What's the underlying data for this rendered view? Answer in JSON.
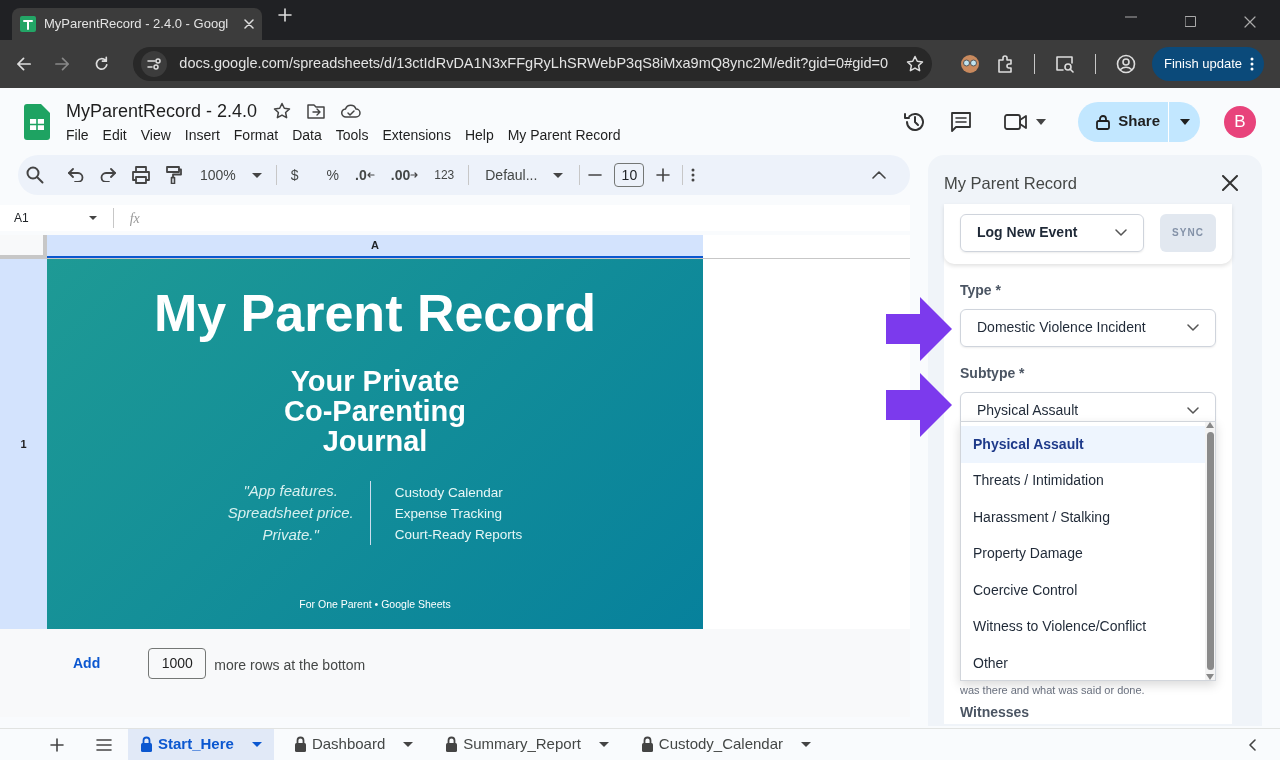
{
  "browser": {
    "tab_title": "MyParentRecord - 2.4.0 - Googl",
    "url": "docs.google.com/spreadsheets/d/13ctIdRvDA1N3xFFgRyLhSRWebP3qS8iMxa9mQ8ync2M/edit?gid=0#gid=0",
    "update_button": "Finish update"
  },
  "sheets": {
    "doc_title": "MyParentRecord - 2.4.0",
    "menus": [
      "File",
      "Edit",
      "View",
      "Insert",
      "Format",
      "Data",
      "Tools",
      "Extensions",
      "Help",
      "My Parent Record"
    ],
    "share": "Share",
    "avatar": "B",
    "toolbar": {
      "zoom": "100%",
      "currency": "$",
      "percent": "%",
      "decrease_decimal": ".0",
      "increase_decimal": ".00",
      "number_format": "123",
      "font": "Defaul...",
      "font_size": "10"
    }
  },
  "formula_bar": {
    "cell_ref": "A1",
    "fx": "fx"
  },
  "grid": {
    "column": "A",
    "row": "1",
    "banner": {
      "title": "My Parent Record",
      "subtitle": [
        "Your Private",
        "Co-Parenting",
        "Journal"
      ],
      "quote": [
        "\"App features.",
        "Spreadsheet price.",
        "Private.\""
      ],
      "features": [
        "Custody Calendar",
        "Expense Tracking",
        "Court-Ready Reports"
      ],
      "footer": "For One Parent • Google Sheets"
    },
    "add_rows": {
      "button": "Add",
      "count": "1000",
      "label": "more rows at the bottom"
    }
  },
  "sheet_tabs": [
    {
      "label": "Start_Here",
      "selected": true
    },
    {
      "label": "Dashboard",
      "selected": false
    },
    {
      "label": "Summary_Report",
      "selected": false
    },
    {
      "label": "Custody_Calendar",
      "selected": false
    }
  ],
  "panel": {
    "title": "My Parent Record",
    "mode_select": "Log New Event",
    "sync": "SYNC",
    "type_label": "Type *",
    "type_value": "Domestic Violence Incident",
    "subtype_label": "Subtype *",
    "subtype_value": "Physical Assault",
    "options": [
      {
        "label": "Physical Assault",
        "selected": true
      },
      {
        "label": "Threats / Intimidation",
        "selected": false
      },
      {
        "label": "Harassment / Stalking",
        "selected": false
      },
      {
        "label": "Property Damage",
        "selected": false
      },
      {
        "label": "Coercive Control",
        "selected": false
      },
      {
        "label": "Witness to Violence/Conflict",
        "selected": false
      },
      {
        "label": "Other",
        "selected": false
      }
    ],
    "hint": "was there and what was said or done.",
    "witnesses_label": "Witnesses"
  }
}
